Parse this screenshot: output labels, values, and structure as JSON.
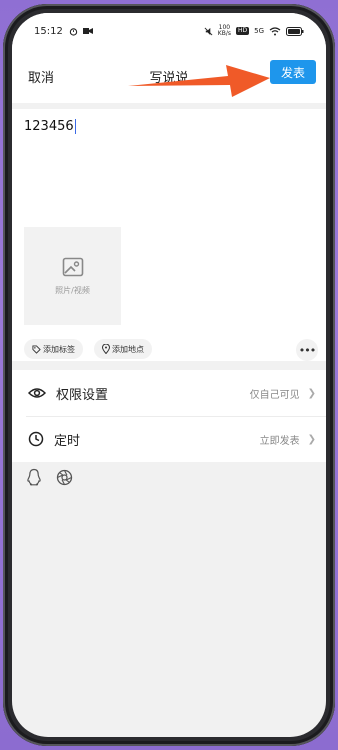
{
  "statusbar": {
    "time": "15:12",
    "network_top": "100",
    "network_bottom": "KB/s",
    "hd": "HD",
    "signal": "5G"
  },
  "nav": {
    "cancel_label": "取消",
    "title": "写说说",
    "post_label": "发表"
  },
  "compose": {
    "text": "123456",
    "media_label": "照片/视频",
    "tag_chip": "添加标签",
    "location_chip": "添加地点",
    "more_label": "•••"
  },
  "settings": {
    "items": [
      {
        "label": "权限设置",
        "value": "仅自己可见",
        "icon": "eye-icon"
      },
      {
        "label": "定时",
        "value": "立即发表",
        "icon": "clock-icon"
      }
    ]
  },
  "share": {
    "icons": [
      "qq-penguin-icon",
      "shutter-icon"
    ]
  },
  "colors": {
    "accent": "#1e96ec",
    "arrow": "#f05a28"
  }
}
